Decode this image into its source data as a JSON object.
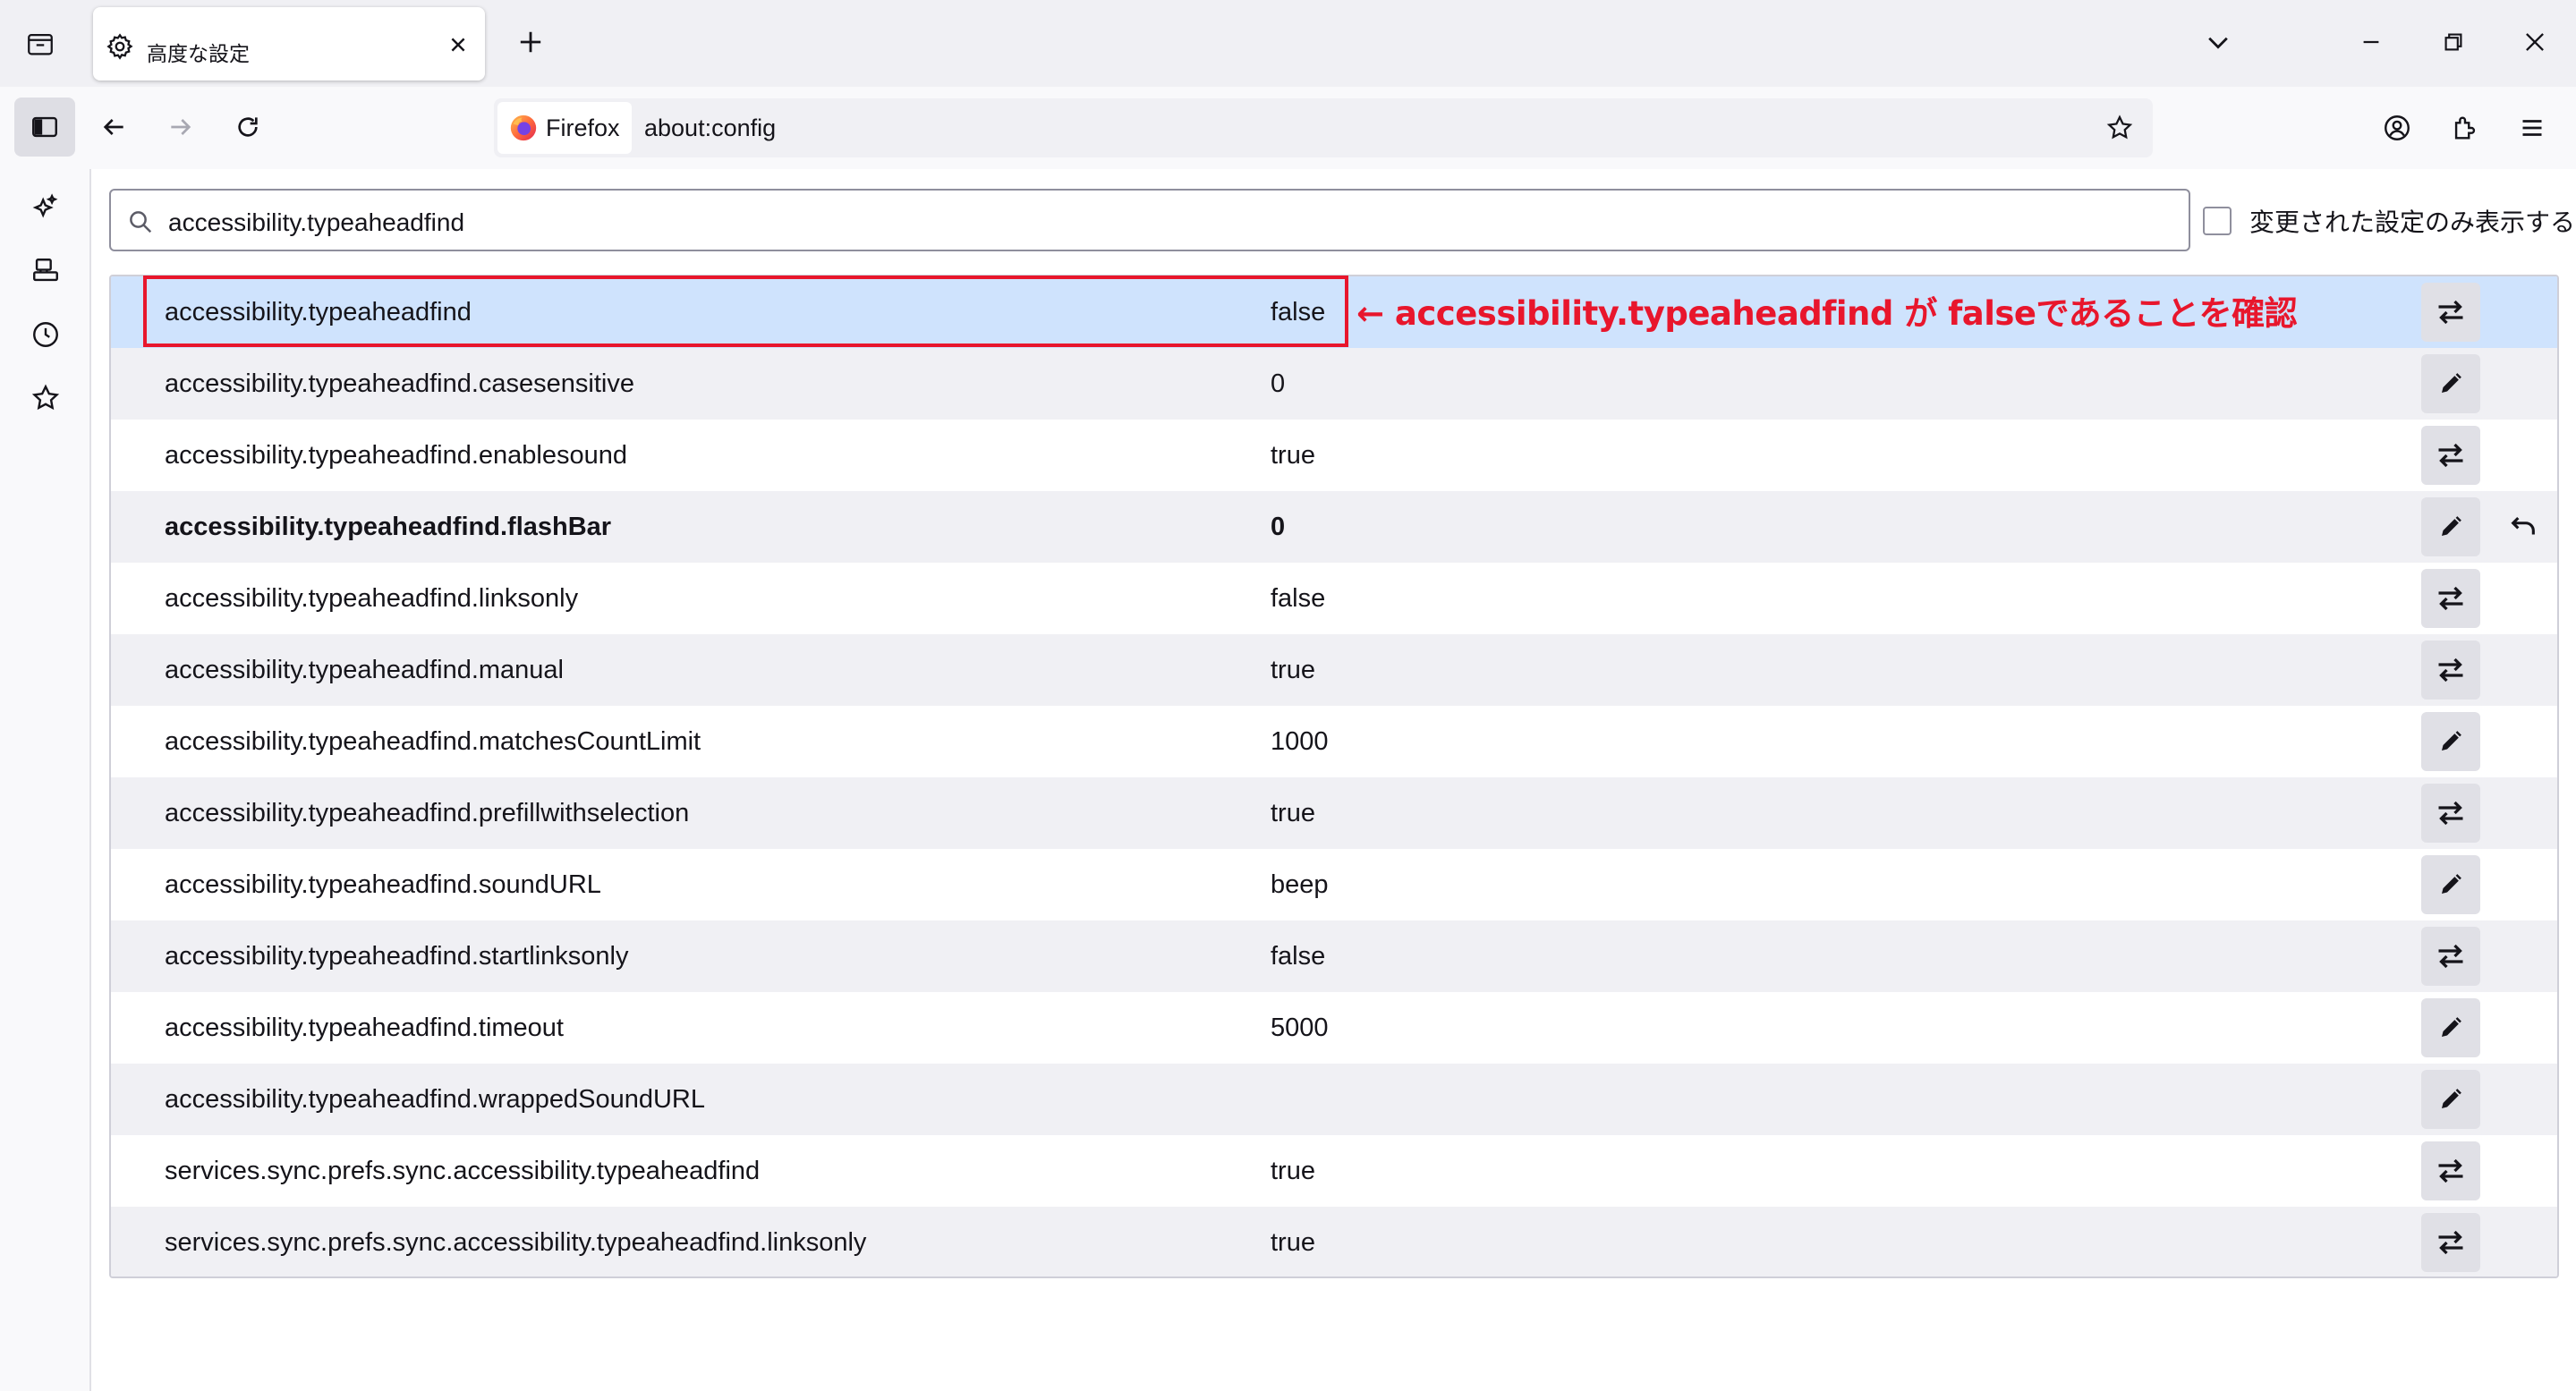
{
  "browser": {
    "tab": {
      "title": "高度な設定",
      "icon": "gear-icon"
    },
    "identity_label": "Firefox",
    "url": "about:config"
  },
  "search": {
    "value": "accessibility.typeaheadfind"
  },
  "filter": {
    "label": "変更された設定のみ表示する",
    "checked": false
  },
  "prefs": [
    {
      "name": "accessibility.typeaheadfind",
      "value": "false",
      "action": "toggle",
      "modified": false,
      "selected": true
    },
    {
      "name": "accessibility.typeaheadfind.casesensitive",
      "value": "0",
      "action": "edit",
      "modified": false
    },
    {
      "name": "accessibility.typeaheadfind.enablesound",
      "value": "true",
      "action": "toggle",
      "modified": false
    },
    {
      "name": "accessibility.typeaheadfind.flashBar",
      "value": "0",
      "action": "edit",
      "modified": true
    },
    {
      "name": "accessibility.typeaheadfind.linksonly",
      "value": "false",
      "action": "toggle",
      "modified": false
    },
    {
      "name": "accessibility.typeaheadfind.manual",
      "value": "true",
      "action": "toggle",
      "modified": false
    },
    {
      "name": "accessibility.typeaheadfind.matchesCountLimit",
      "value": "1000",
      "action": "edit",
      "modified": false
    },
    {
      "name": "accessibility.typeaheadfind.prefillwithselection",
      "value": "true",
      "action": "toggle",
      "modified": false
    },
    {
      "name": "accessibility.typeaheadfind.soundURL",
      "value": "beep",
      "action": "edit",
      "modified": false
    },
    {
      "name": "accessibility.typeaheadfind.startlinksonly",
      "value": "false",
      "action": "toggle",
      "modified": false
    },
    {
      "name": "accessibility.typeaheadfind.timeout",
      "value": "5000",
      "action": "edit",
      "modified": false
    },
    {
      "name": "accessibility.typeaheadfind.wrappedSoundURL",
      "value": "",
      "action": "edit",
      "modified": false
    },
    {
      "name": "services.sync.prefs.sync.accessibility.typeaheadfind",
      "value": "true",
      "action": "toggle",
      "modified": false
    },
    {
      "name": "services.sync.prefs.sync.accessibility.typeaheadfind.linksonly",
      "value": "true",
      "action": "toggle",
      "modified": false
    }
  ],
  "annotation": {
    "text": "← accessibility.typeaheadfind が falseであることを確認"
  },
  "colors": {
    "annotation": "#e8162c",
    "selected_row": "#cfe3fd",
    "stripe": "#f0f0f4"
  }
}
